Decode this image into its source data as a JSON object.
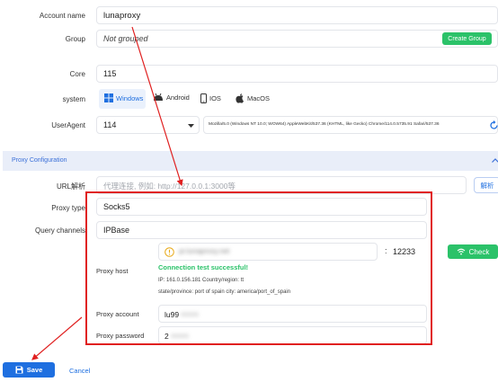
{
  "form": {
    "account_name_label": "Account name",
    "account_name_value": "lunaproxy",
    "group_label": "Group",
    "group_value": "Not grouped",
    "create_group_label": "Create Group",
    "core_label": "Core",
    "core_value": "115",
    "system_label": "system",
    "os_options": [
      {
        "label": "Windows",
        "selected": true
      },
      {
        "label": "Android",
        "selected": false
      },
      {
        "label": "IOS",
        "selected": false
      },
      {
        "label": "MacOS",
        "selected": false
      }
    ],
    "useragent_label": "UserAgent",
    "useragent_version": "114",
    "useragent_string": "Mozilla/5.0 (Windows NT 10.0; WOW64) AppleWebKit/537.36 (KHTML, like Gecko) Chrome/114.0.5735.91 Safari/537.36"
  },
  "proxy_section": {
    "title": "Proxy Configuration",
    "url_parse_label": "URL解析",
    "url_parse_placeholder": "代理连接, 例如: http://127.0.0.1:3000等",
    "url_parse_button": "解析",
    "proxy_type_label": "Proxy type",
    "proxy_type_value": "Socks5",
    "query_channels_label": "Query channels",
    "query_channels_value": "IPBase",
    "proxy_host_label": "Proxy host",
    "proxy_host_value": "pr.lunaproxy.net",
    "port_separator": ":",
    "proxy_port_value": "12233",
    "check_label": "Check",
    "test_status": "Connection test successful!",
    "ip_info": "IP: 161.0.156.181 Country/region: tt",
    "location_info": "state/province: port of spain city: america/port_of_spain",
    "proxy_account_label": "Proxy account",
    "proxy_account_value": "lu99",
    "proxy_account_hidden": "xxxxx",
    "proxy_password_label": "Proxy password",
    "proxy_password_value": "2",
    "proxy_password_hidden": "xxxxx"
  },
  "footer": {
    "save_label": "Save",
    "cancel_label": "Cancel"
  },
  "colors": {
    "accent": "#1e6fe0",
    "green": "#2bc269",
    "annotation_red": "#e02020",
    "section_bg": "#e9eef9"
  }
}
